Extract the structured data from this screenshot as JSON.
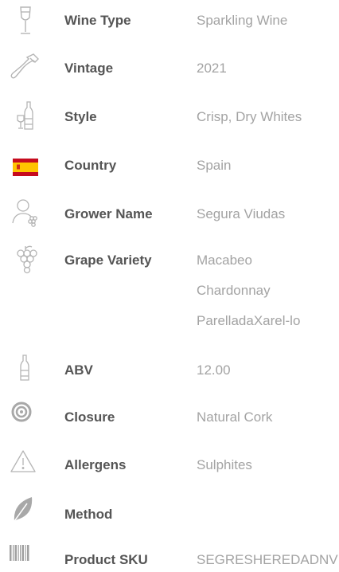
{
  "colors": {
    "label": "#555555",
    "value": "#a3a3a3",
    "icon": "#b5b5b5",
    "flag_red": "#c60b1e",
    "flag_yellow": "#ffc400"
  },
  "rows": [
    {
      "label": "Wine Type",
      "value": "Sparkling Wine",
      "icon": "champagne-glass-icon"
    },
    {
      "label": "Vintage",
      "value": "2021",
      "icon": "wine-bottle-tilted-icon"
    },
    {
      "label": "Style",
      "value": "Crisp, Dry Whites",
      "icon": "bottle-and-glass-icon"
    },
    {
      "label": "Country",
      "value": "Spain",
      "icon": "spain-flag-icon"
    },
    {
      "label": "Grower Name",
      "value": "Segura Viudas",
      "icon": "grower-person-icon"
    },
    {
      "label": "Grape Variety",
      "values": [
        "Macabeo",
        "Chardonnay",
        "ParelladaXarel-lo"
      ],
      "icon": "grapes-icon"
    },
    {
      "label": "ABV",
      "value": "12.00",
      "icon": "bottle-icon"
    },
    {
      "label": "Closure",
      "value": "Natural Cork",
      "icon": "cork-target-icon"
    },
    {
      "label": "Allergens",
      "value": "Sulphites",
      "icon": "warning-icon"
    },
    {
      "label": "Method",
      "value": "",
      "icon": "leaf-icon"
    },
    {
      "label": "Product SKU",
      "value": "SEGRESHEREDADNV",
      "icon": "barcode-icon"
    }
  ]
}
